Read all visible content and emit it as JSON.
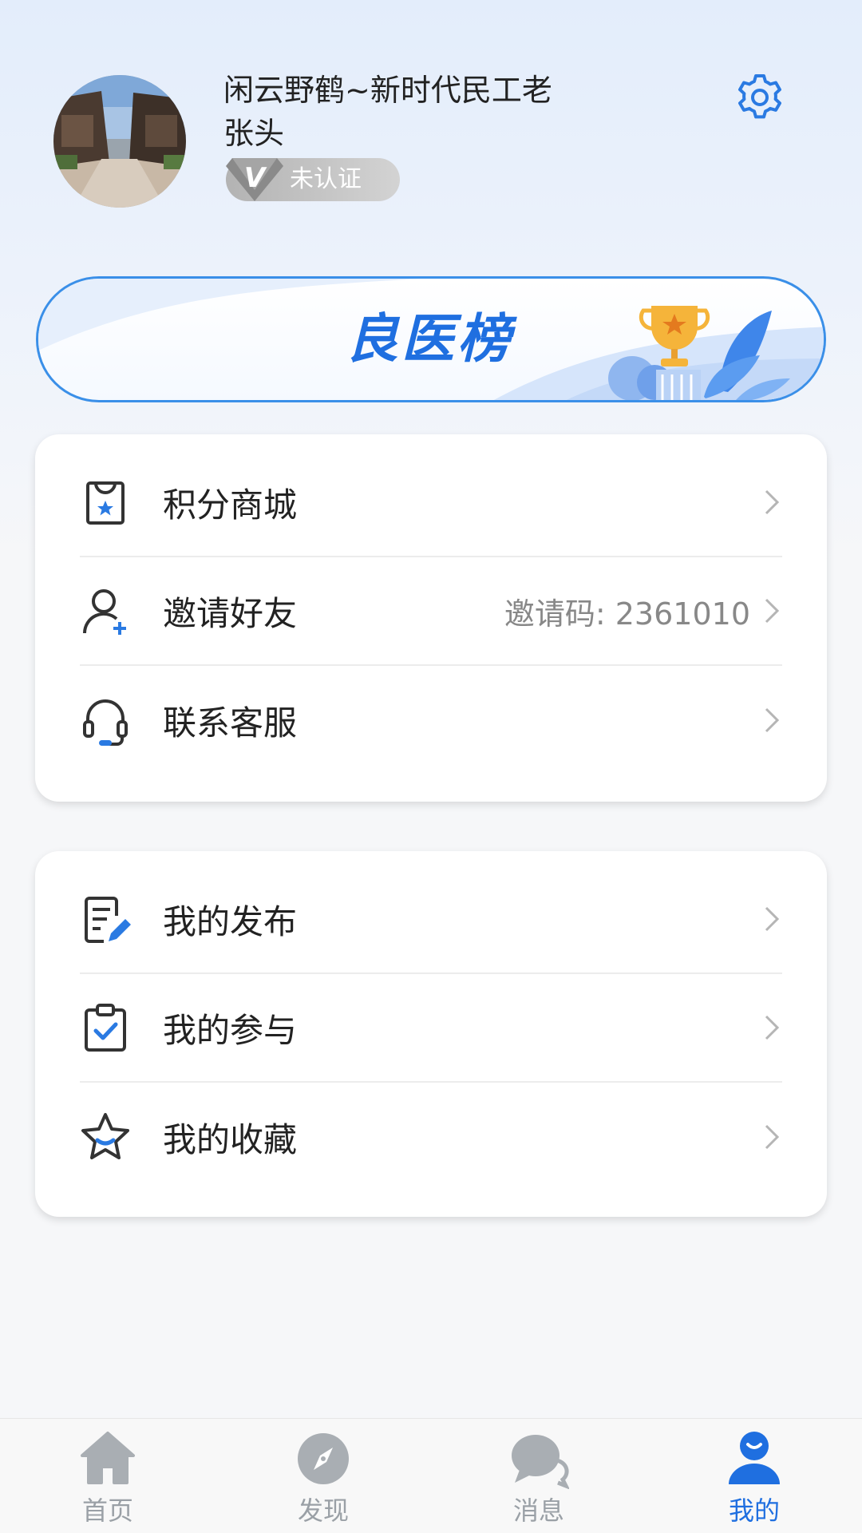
{
  "profile": {
    "name": "闲云野鹤~新时代民工老张头",
    "verify_status": "未认证"
  },
  "banner": {
    "title": "良医榜"
  },
  "menu_group_1": [
    {
      "label": "积分商城",
      "icon": "shop-bag-icon",
      "extra": ""
    },
    {
      "label": "邀请好友",
      "icon": "add-user-icon",
      "extra": "邀请码:  2361010"
    },
    {
      "label": "联系客服",
      "icon": "headset-icon",
      "extra": ""
    }
  ],
  "menu_group_2": [
    {
      "label": "我的发布",
      "icon": "edit-document-icon"
    },
    {
      "label": "我的参与",
      "icon": "clipboard-check-icon"
    },
    {
      "label": "我的收藏",
      "icon": "star-icon"
    }
  ],
  "tabbar": [
    {
      "label": "首页",
      "icon": "home-icon",
      "active": false
    },
    {
      "label": "发现",
      "icon": "compass-icon",
      "active": false
    },
    {
      "label": "消息",
      "icon": "chat-icon",
      "active": false
    },
    {
      "label": "我的",
      "icon": "user-icon",
      "active": true
    }
  ],
  "colors": {
    "accent": "#1f6fe0",
    "inactive": "#9aa0a6",
    "badge": "#b8b8b8"
  }
}
